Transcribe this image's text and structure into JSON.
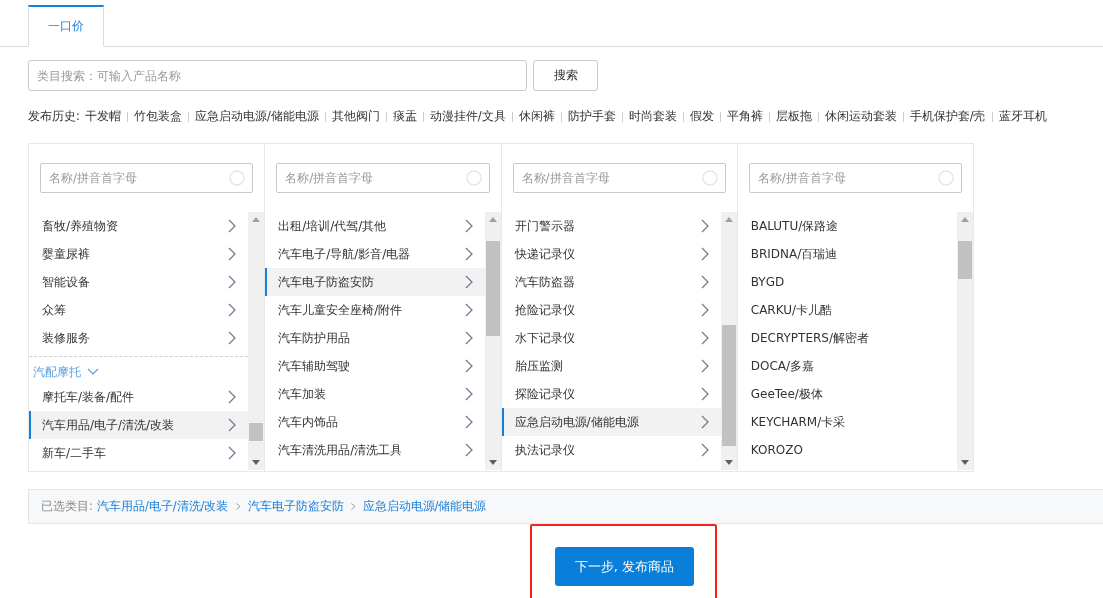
{
  "tabs": [
    {
      "label": "一口价",
      "selected": true
    }
  ],
  "search": {
    "placeholder": "类目搜索：可输入产品名称",
    "button": "搜索"
  },
  "history": {
    "label": "发布历史:",
    "items": [
      "干发帽",
      "竹包装盒",
      "应急启动电源/储能电源",
      "其他阀门",
      "痰盂",
      "动漫挂件/文具",
      "休闲裤",
      "防护手套",
      "时尚套装",
      "假发",
      "平角裤",
      "层板拖",
      "休闲运动套装",
      "手机保护套/壳",
      "蓝牙耳机"
    ]
  },
  "columns": [
    {
      "placeholder": "名称/拼音首字母",
      "items": [
        {
          "kind": "branch",
          "label": "畜牧/养殖物资",
          "selected": false
        },
        {
          "kind": "branch",
          "label": "婴童尿裤",
          "selected": false
        },
        {
          "kind": "branch",
          "label": "智能设备",
          "selected": false
        },
        {
          "kind": "branch",
          "label": "众筹",
          "selected": false
        },
        {
          "kind": "branch",
          "label": "装修服务",
          "selected": false
        },
        {
          "kind": "group",
          "label": "汽配摩托",
          "expanded": true
        },
        {
          "kind": "branch",
          "label": "摩托车/装备/配件",
          "selected": false
        },
        {
          "kind": "branch",
          "label": "汽车用品/电子/清洗/改装",
          "selected": true
        },
        {
          "kind": "branch",
          "label": "新车/二手车",
          "selected": false
        }
      ]
    },
    {
      "placeholder": "名称/拼音首字母",
      "items": [
        {
          "kind": "branch",
          "label": "出租/培训/代驾/其他",
          "selected": false
        },
        {
          "kind": "branch",
          "label": "汽车电子/导航/影音/电器",
          "selected": false
        },
        {
          "kind": "branch",
          "label": "汽车电子防盗安防",
          "selected": true
        },
        {
          "kind": "branch",
          "label": "汽车儿童安全座椅/附件",
          "selected": false
        },
        {
          "kind": "branch",
          "label": "汽车防护用品",
          "selected": false
        },
        {
          "kind": "branch",
          "label": "汽车辅助驾驶",
          "selected": false
        },
        {
          "kind": "branch",
          "label": "汽车加装",
          "selected": false
        },
        {
          "kind": "branch",
          "label": "汽车内饰品",
          "selected": false
        },
        {
          "kind": "branch",
          "label": "汽车清洗用品/清洗工具",
          "selected": false
        }
      ]
    },
    {
      "placeholder": "名称/拼音首字母",
      "items": [
        {
          "kind": "branch",
          "label": "开门警示器",
          "selected": false
        },
        {
          "kind": "branch",
          "label": "快递记录仪",
          "selected": false
        },
        {
          "kind": "branch",
          "label": "汽车防盗器",
          "selected": false
        },
        {
          "kind": "branch",
          "label": "抢险记录仪",
          "selected": false
        },
        {
          "kind": "branch",
          "label": "水下记录仪",
          "selected": false
        },
        {
          "kind": "branch",
          "label": "胎压监测",
          "selected": false
        },
        {
          "kind": "branch",
          "label": "探险记录仪",
          "selected": false
        },
        {
          "kind": "branch",
          "label": "应急启动电源/储能电源",
          "selected": true
        },
        {
          "kind": "branch",
          "label": "执法记录仪",
          "selected": false
        }
      ]
    },
    {
      "placeholder": "名称/拼音首字母",
      "items": [
        {
          "kind": "leaf",
          "label": "BALUTU/保路途",
          "selected": false
        },
        {
          "kind": "leaf",
          "label": "BRIDNA/百瑞迪",
          "selected": false
        },
        {
          "kind": "leaf",
          "label": "BYGD",
          "selected": false
        },
        {
          "kind": "leaf",
          "label": "CARKU/卡儿酷",
          "selected": false
        },
        {
          "kind": "leaf",
          "label": "DECRYPTERS/解密者",
          "selected": false
        },
        {
          "kind": "leaf",
          "label": "DOCA/多嘉",
          "selected": false
        },
        {
          "kind": "leaf",
          "label": "GeeTee/极体",
          "selected": false
        },
        {
          "kind": "leaf",
          "label": "KEYCHARM/卡采",
          "selected": false
        },
        {
          "kind": "leaf",
          "label": "KOROZO",
          "selected": false
        }
      ]
    }
  ],
  "selected_path": {
    "label": "已选类目:",
    "items": [
      "汽车用品/电子/清洗/改装",
      "汽车电子防盗安防",
      "应急启动电源/储能电源"
    ]
  },
  "next_button": {
    "label": "下一步, 发布商品",
    "highlighted": true
  }
}
